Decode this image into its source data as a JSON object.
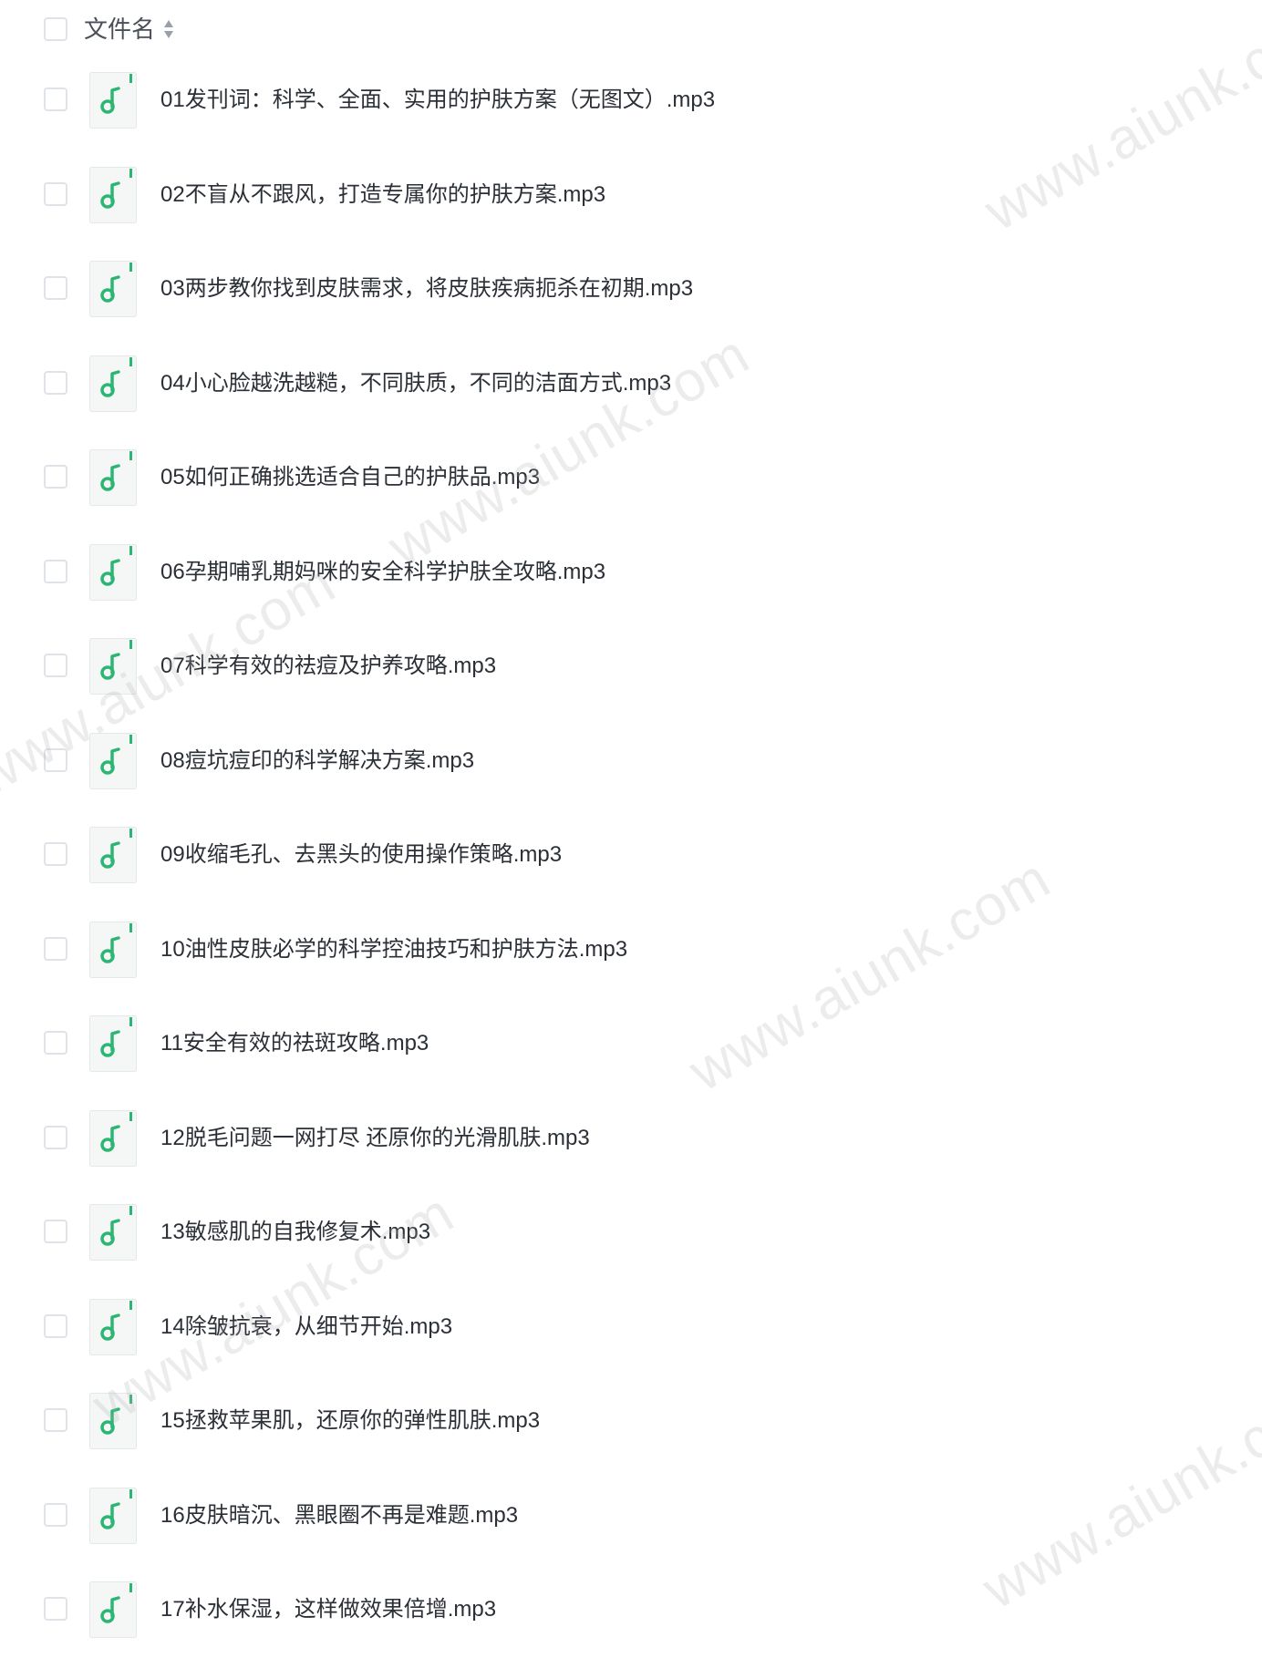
{
  "header": {
    "column_label": "文件名",
    "sort_icon": "sort-icon"
  },
  "file_icon": "music-file-icon",
  "accent_color": "#2bb673",
  "files": [
    "01发刊词：科学、全面、实用的护肤方案（无图文）.mp3",
    "02不盲从不跟风，打造专属你的护肤方案.mp3",
    "03两步教你找到皮肤需求，将皮肤疾病扼杀在初期.mp3",
    "04小心脸越洗越糙，不同肤质，不同的洁面方式.mp3",
    "05如何正确挑选适合自己的护肤品.mp3",
    "06孕期哺乳期妈咪的安全科学护肤全攻略.mp3",
    "07科学有效的祛痘及护养攻略.mp3",
    "08痘坑痘印的科学解决方案.mp3",
    "09收缩毛孔、去黑头的使用操作策略.mp3",
    "10油性皮肤必学的科学控油技巧和护肤方法.mp3",
    "11安全有效的祛斑攻略.mp3",
    "12脱毛问题一网打尽 还原你的光滑肌肤.mp3",
    "13敏感肌的自我修复术.mp3",
    "14除皱抗衰，从细节开始.mp3",
    "15拯救苹果肌，还原你的弹性肌肤.mp3",
    "16皮肤暗沉、黑眼圈不再是难题.mp3",
    "17补水保湿，这样做效果倍增.mp3"
  ],
  "watermark_text": "www.aiunk.com"
}
